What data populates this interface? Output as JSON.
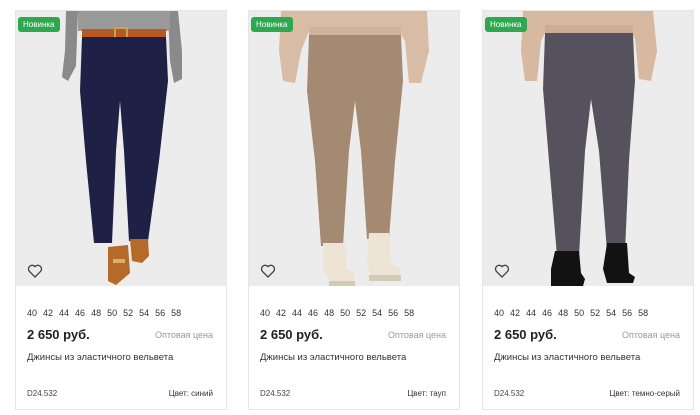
{
  "colors": {
    "badge": "#2ea84e"
  },
  "products": [
    {
      "badge": "Новинка",
      "image": "navy-corduroy-trousers",
      "sizes": [
        "40",
        "42",
        "44",
        "46",
        "48",
        "50",
        "52",
        "54",
        "56",
        "58"
      ],
      "price": "2 650 руб.",
      "price_note": "Оптовая цена",
      "title": "Джинсы из эластичного вельвета",
      "sku": "D24.532",
      "color": "Цвет: синий",
      "favorite_icon": "heart-icon"
    },
    {
      "badge": "Новинка",
      "image": "taupe-corduroy-trousers",
      "sizes": [
        "40",
        "42",
        "44",
        "46",
        "48",
        "50",
        "52",
        "54",
        "56",
        "58"
      ],
      "price": "2 650 руб.",
      "price_note": "Оптовая цена",
      "title": "Джинсы из эластичного вельвета",
      "sku": "D24.532",
      "color": "Цвет: тауп",
      "favorite_icon": "heart-icon"
    },
    {
      "badge": "Новинка",
      "image": "dark-grey-corduroy-trousers",
      "sizes": [
        "40",
        "42",
        "44",
        "46",
        "48",
        "50",
        "52",
        "54",
        "56",
        "58"
      ],
      "price": "2 650 руб.",
      "price_note": "Оптовая цена",
      "title": "Джинсы из эластичного вельвета",
      "sku": "D24.532",
      "color": "Цвет: темно-серый",
      "favorite_icon": "heart-icon"
    }
  ]
}
